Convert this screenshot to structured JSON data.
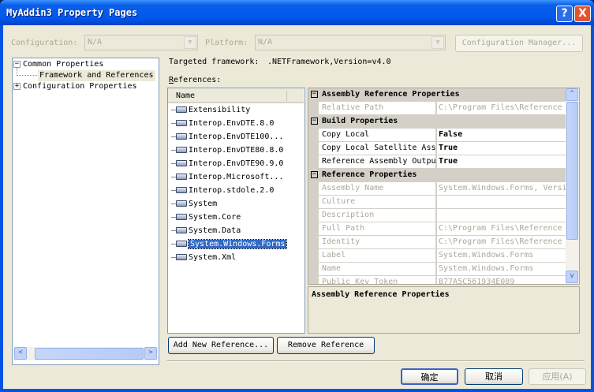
{
  "window": {
    "title": "MyAddin3 Property Pages",
    "help_label": "?",
    "close_label": "X"
  },
  "config": {
    "configuration_label": "Configuration:",
    "configuration_value": "N/A",
    "platform_label": "Platform:",
    "platform_value": "N/A",
    "manager_label": "Configuration Manager..."
  },
  "tree": {
    "items": [
      {
        "label": "Common Properties",
        "expander": "−"
      },
      {
        "label": "Framework and References"
      },
      {
        "label": "Configuration Properties",
        "expander": "+"
      }
    ]
  },
  "main": {
    "framework_label": "Targeted framework:",
    "framework_value": ".NETFramework,Version=v4.0",
    "references_label": "References:"
  },
  "references": {
    "column": "Name",
    "items": [
      "Extensibility",
      "Interop.EnvDTE.8.0",
      "Interop.EnvDTE100...",
      "Interop.EnvDTE80.8.0",
      "Interop.EnvDTE90.9.0",
      "Interop.Microsoft...",
      "Interop.stdole.2.0",
      "System",
      "System.Core",
      "System.Data",
      "System.Windows.Forms",
      "System.Xml"
    ],
    "selected": "System.Windows.Forms"
  },
  "properties": {
    "rows": [
      {
        "type": "cat",
        "name": "Assembly Reference Properties"
      },
      {
        "type": "gray",
        "name": "Relative Path",
        "value": "C:\\Program Files\\Reference"
      },
      {
        "type": "cat",
        "name": "Build Properties"
      },
      {
        "type": "edit",
        "name": "Copy Local",
        "value": "False"
      },
      {
        "type": "edit",
        "name": "Copy Local Satellite Ass",
        "value": "True"
      },
      {
        "type": "edit",
        "name": "Reference Assembly Outpu",
        "value": "True"
      },
      {
        "type": "cat",
        "name": "Reference Properties"
      },
      {
        "type": "gray",
        "name": "Assembly Name",
        "value": "System.Windows.Forms, Versi"
      },
      {
        "type": "gray",
        "name": "Culture",
        "value": ""
      },
      {
        "type": "gray",
        "name": "Description",
        "value": ""
      },
      {
        "type": "gray",
        "name": "Full Path",
        "value": "C:\\Program Files\\Reference"
      },
      {
        "type": "gray",
        "name": "Identity",
        "value": "C:\\Program Files\\Reference"
      },
      {
        "type": "gray",
        "name": "Label",
        "value": "System.Windows.Forms"
      },
      {
        "type": "gray",
        "name": "Name",
        "value": "System.Windows.Forms"
      },
      {
        "type": "gray",
        "name": "Public Key Token",
        "value": "B77A5C561934E089"
      }
    ],
    "description_title": "Assembly Reference Properties"
  },
  "buttons": {
    "add_reference": "Add New Reference...",
    "remove_reference": "Remove Reference",
    "ok": "确定",
    "cancel": "取消",
    "apply": "应用(A)"
  }
}
